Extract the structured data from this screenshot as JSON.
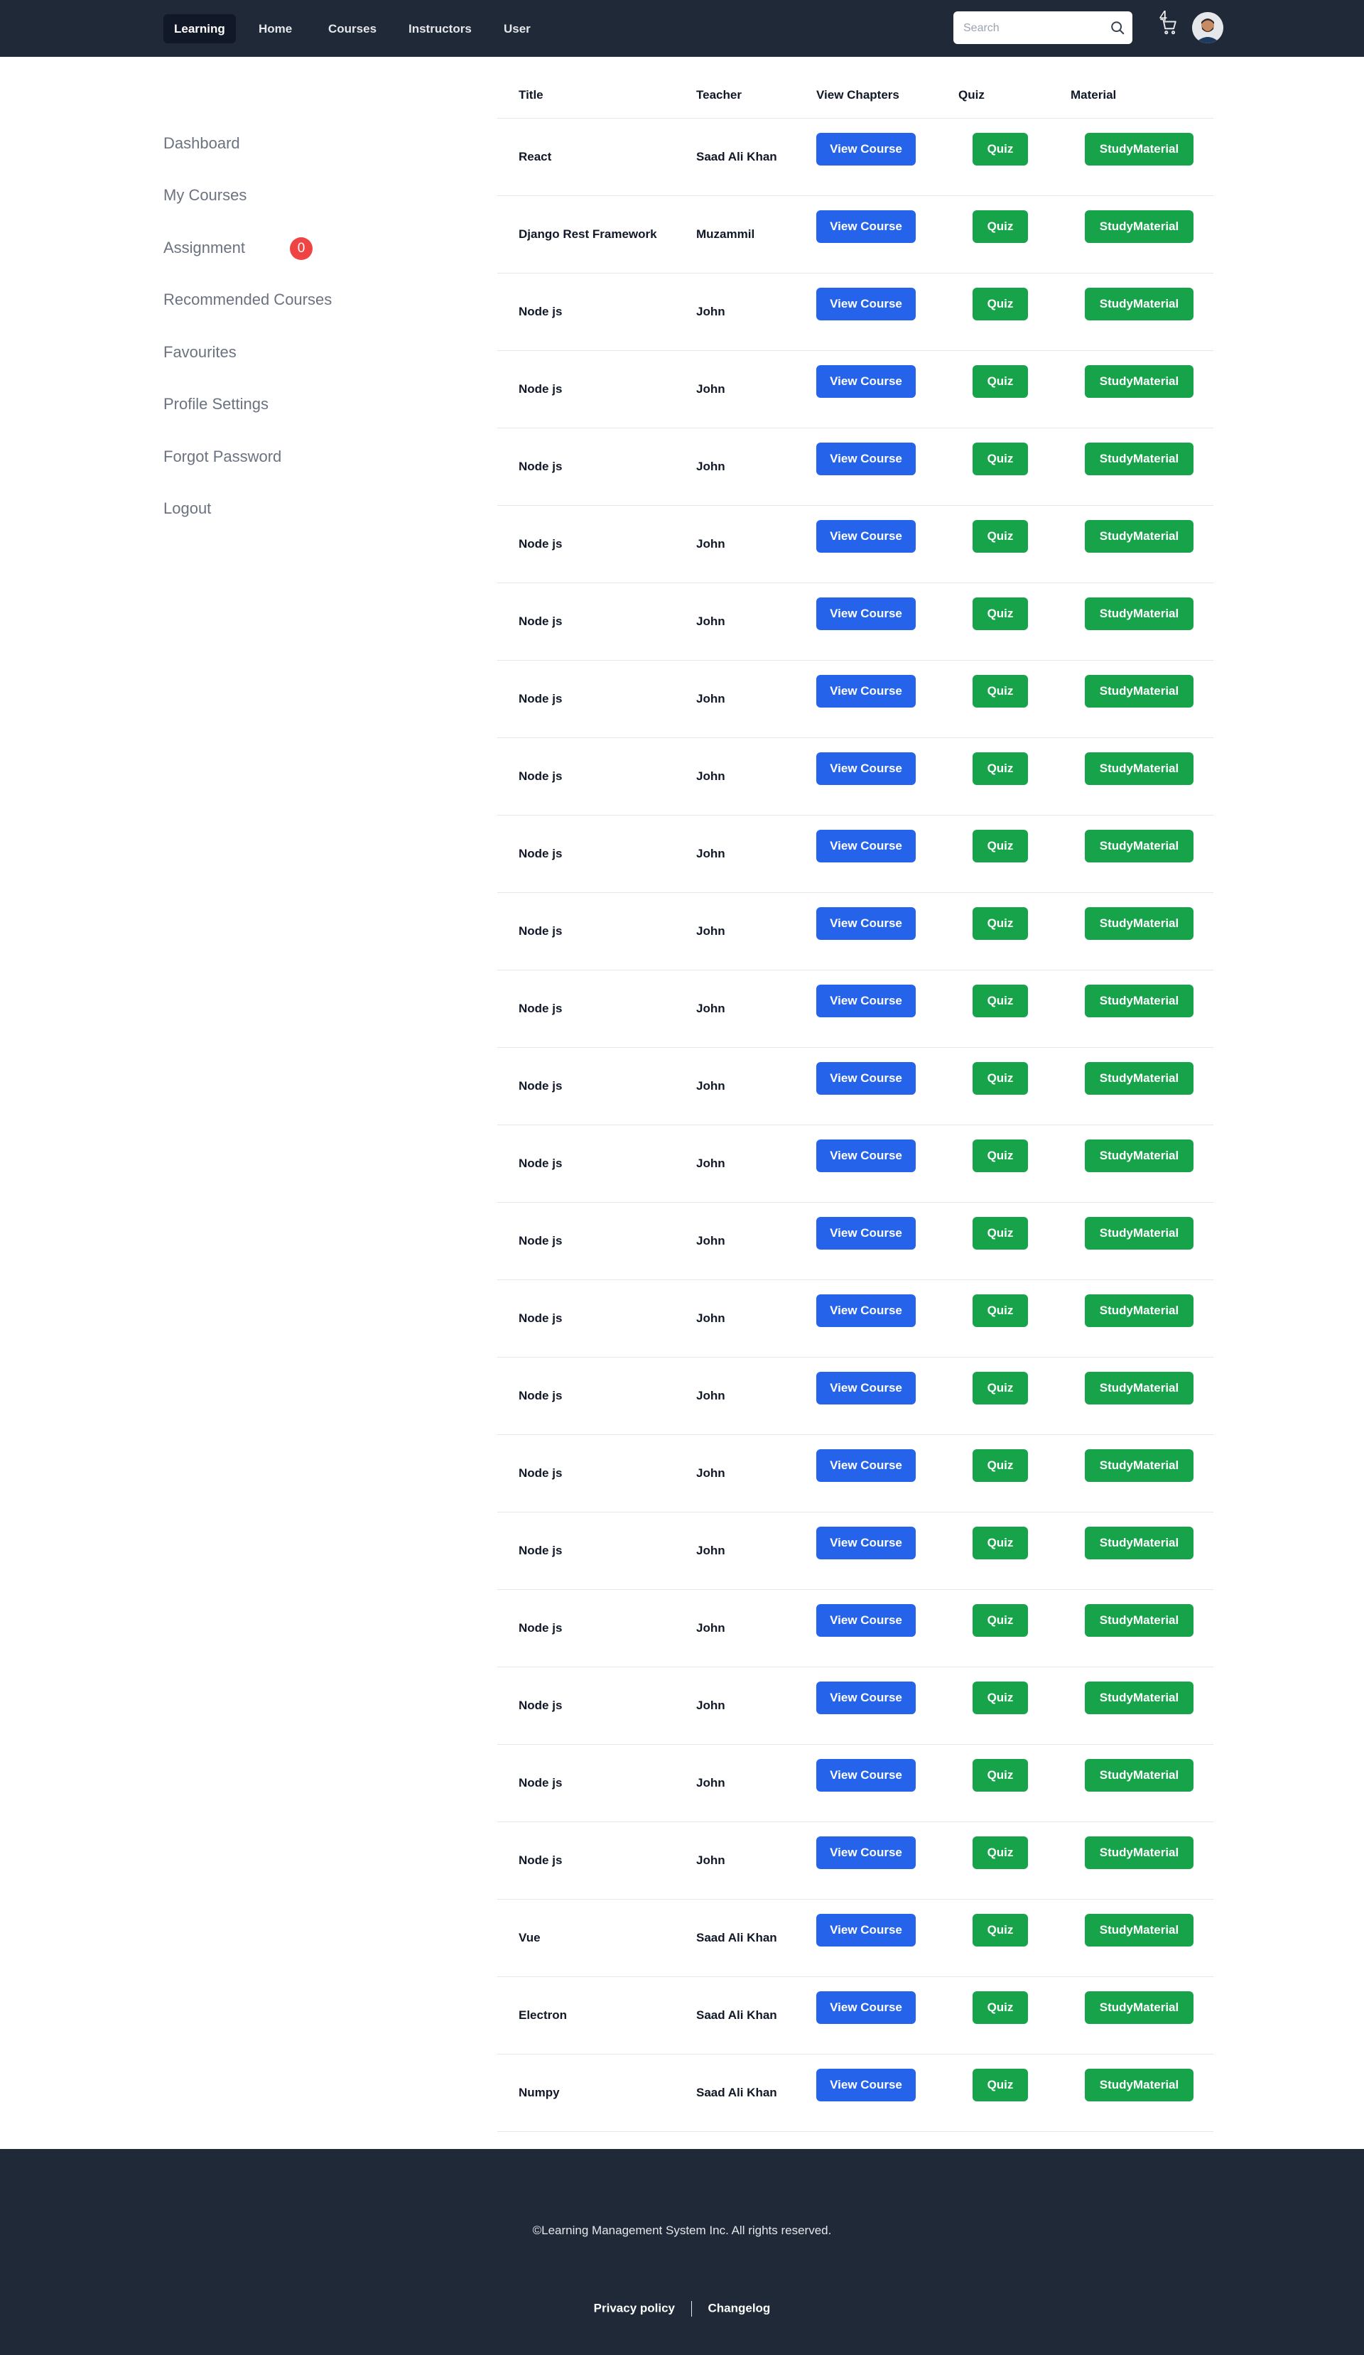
{
  "navbar": {
    "brand": "Learning",
    "links": [
      "Home",
      "Courses",
      "Instructors",
      "User"
    ],
    "search_placeholder": "Search",
    "cart_count": "4",
    "icons": {
      "search": "search-icon",
      "cart": "cart-icon",
      "avatar": "user-avatar"
    }
  },
  "sidebar": {
    "items": [
      "Dashboard",
      "My Courses",
      "Assignment",
      "Recommended Courses",
      "Favourites",
      "Profile Settings",
      "Forgot Password",
      "Logout"
    ],
    "assignment_badge": "0"
  },
  "table": {
    "headers": {
      "title": "Title",
      "teacher": "Teacher",
      "chapters": "View Chapters",
      "quiz": "Quiz",
      "material": "Material"
    },
    "buttons": {
      "view": "View Course",
      "quiz": "Quiz",
      "material": "StudyMaterial"
    },
    "rows": [
      {
        "title": "React",
        "teacher": "Saad Ali Khan"
      },
      {
        "title": "Django Rest Framework",
        "teacher": "Muzammil"
      },
      {
        "title": "Node js",
        "teacher": "John"
      },
      {
        "title": "Node js",
        "teacher": "John"
      },
      {
        "title": "Node js",
        "teacher": "John"
      },
      {
        "title": "Node js",
        "teacher": "John"
      },
      {
        "title": "Node js",
        "teacher": "John"
      },
      {
        "title": "Node js",
        "teacher": "John"
      },
      {
        "title": "Node js",
        "teacher": "John"
      },
      {
        "title": "Node js",
        "teacher": "John"
      },
      {
        "title": "Node js",
        "teacher": "John"
      },
      {
        "title": "Node js",
        "teacher": "John"
      },
      {
        "title": "Node js",
        "teacher": "John"
      },
      {
        "title": "Node js",
        "teacher": "John"
      },
      {
        "title": "Node js",
        "teacher": "John"
      },
      {
        "title": "Node js",
        "teacher": "John"
      },
      {
        "title": "Node js",
        "teacher": "John"
      },
      {
        "title": "Node js",
        "teacher": "John"
      },
      {
        "title": "Node js",
        "teacher": "John"
      },
      {
        "title": "Node js",
        "teacher": "John"
      },
      {
        "title": "Node js",
        "teacher": "John"
      },
      {
        "title": "Node js",
        "teacher": "John"
      },
      {
        "title": "Node js",
        "teacher": "John"
      },
      {
        "title": "Vue",
        "teacher": "Saad Ali Khan"
      },
      {
        "title": "Electron",
        "teacher": "Saad Ali Khan"
      },
      {
        "title": "Numpy",
        "teacher": "Saad Ali Khan"
      }
    ]
  },
  "footer": {
    "copyright": "©Learning Management System Inc. All rights reserved.",
    "links": [
      "Privacy policy",
      "Changelog"
    ]
  },
  "colors": {
    "navbar_bg": "#1f2937",
    "primary_button": "#2563eb",
    "success_button": "#16a34a",
    "badge": "#ef4444"
  }
}
